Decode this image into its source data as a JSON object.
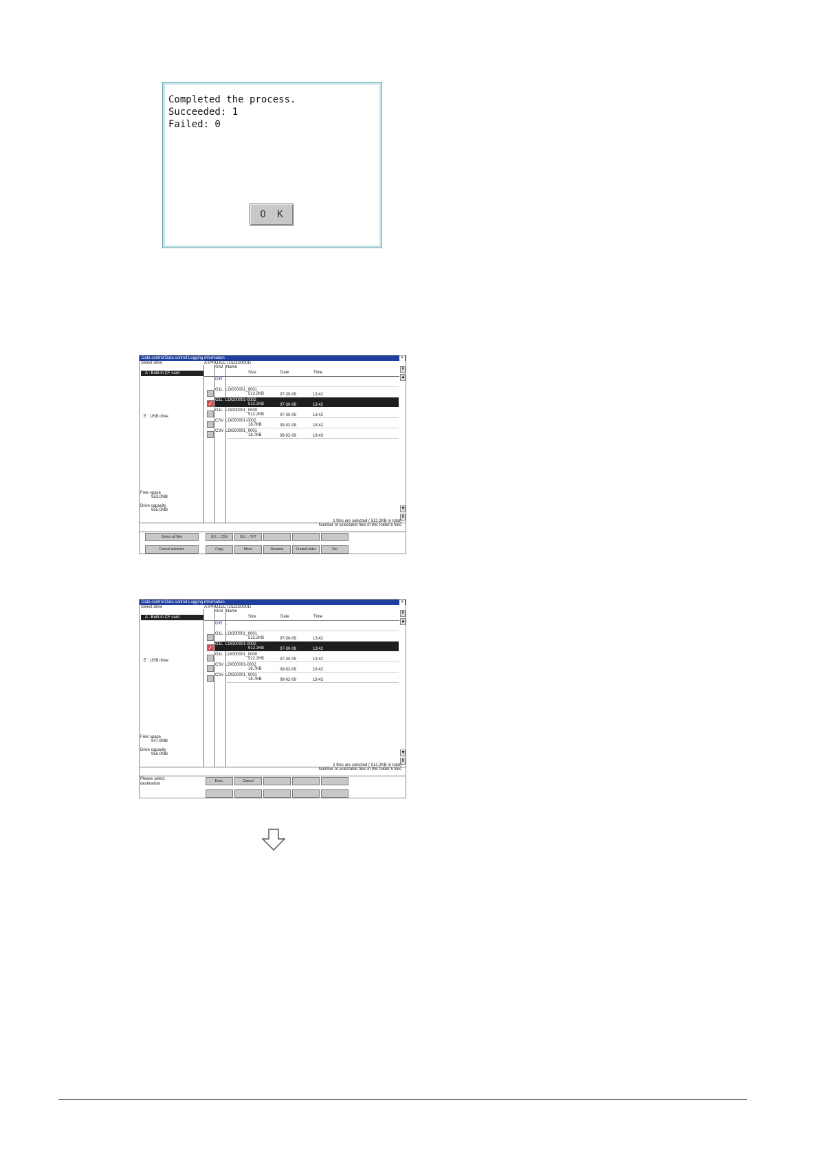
{
  "dialog": {
    "line1": "Completed the process.",
    "line2": "Succeeded: 1",
    "line3": "Failed: 0",
    "ok_label": "O K"
  },
  "screen1": {
    "title": "Data control:Data control:Logging information",
    "close": "×",
    "path": "A:\\PROJECT1\\LOG0001\\",
    "select_drive": "Select drive",
    "drive_a": "A : Built-in CF card",
    "drive_e": "E : USB drive",
    "free_space_label": "Free space",
    "free_space_value": "953.0MB",
    "capacity_label": "Drive capacity",
    "capacity_value": "955.0MB",
    "headers": {
      "kind": "Kind",
      "name": "Name",
      "size": "Size",
      "date": "Date",
      "time": "Time"
    },
    "rows": [
      {
        "kind": "DIR",
        "name": "..",
        "size": "",
        "date": "",
        "time": ""
      },
      {
        "kind": "G1L",
        "name": "LOG00001_0001",
        "size": "512.2KB",
        "date": "07-30-09",
        "time": "13:42"
      },
      {
        "kind": "G1L",
        "name": "LOG00001-0002",
        "size": "512.2KB",
        "date": "07-30-09",
        "time": "13:42"
      },
      {
        "kind": "G1L",
        "name": "LOG00001_0000",
        "size": "512.2KB",
        "date": "07-30-09",
        "time": "13:42"
      },
      {
        "kind": "CSV",
        "name": "LOG00001-0002",
        "size": "18.7KB",
        "date": "09-02-09",
        "time": "18:42"
      },
      {
        "kind": "CSV",
        "name": "LOG00001_0001",
        "size": "18.7KB",
        "date": "09-02-09",
        "time": "18:43"
      }
    ],
    "status1": "1 files are selected ( 512.2KB in total)",
    "status2": "Number of selectable files in this folder:5 files",
    "buttons": {
      "select_all": "Select all files",
      "cancel_selection": "Cancel selection",
      "g1l_csv": "G1L→CSV",
      "g1l_txt": "G1L→TXT",
      "copy": "Copy",
      "move": "Move",
      "rename": "Rename",
      "create_folder": "CreateFolder",
      "del": "Del"
    }
  },
  "screen2": {
    "title": "Data control:Data control:Logging information",
    "close": "×",
    "path": "A:\\PROJECT1\\LOG0001\\",
    "select_drive": "Select drive",
    "drive_a": "A : Built-in CF card",
    "drive_e": "E : USB drive",
    "free_space_label": "Free space",
    "free_space_value": "947.9MB",
    "capacity_label": "Drive capacity",
    "capacity_value": "955.0MB",
    "headers": {
      "kind": "Kind",
      "name": "Name",
      "size": "Size",
      "date": "Date",
      "time": "Time"
    },
    "rows": [
      {
        "kind": "DIR",
        "name": "..",
        "size": "",
        "date": "",
        "time": ""
      },
      {
        "kind": "G1L",
        "name": "LOG00001_0001",
        "size": "512.2KB",
        "date": "07-30-09",
        "time": "13:42"
      },
      {
        "kind": "G1L",
        "name": "LOG00001-0002",
        "size": "512.2KB",
        "date": "07-30-09",
        "time": "13:42"
      },
      {
        "kind": "G1L",
        "name": "LOG00001_0000",
        "size": "512.2KB",
        "date": "07-30-09",
        "time": "13:42"
      },
      {
        "kind": "CSV",
        "name": "LOG00001-0002",
        "size": "18.7KB",
        "date": "09-02-09",
        "time": "18:42"
      },
      {
        "kind": "CSV",
        "name": "LOG00001_0001",
        "size": "18.7KB",
        "date": "09-02-09",
        "time": "18:43"
      }
    ],
    "status1": "1 files are selected ( 512.2KB in total)",
    "status2": "Number of selectable files in this folder:5 files",
    "prompt1": "Please select",
    "prompt2": "destination",
    "buttons": {
      "exec": "Exec.",
      "cancel": "Cancel"
    }
  },
  "icons": {
    "arrow": "down-arrow-icon",
    "check": "checkmark-icon"
  }
}
